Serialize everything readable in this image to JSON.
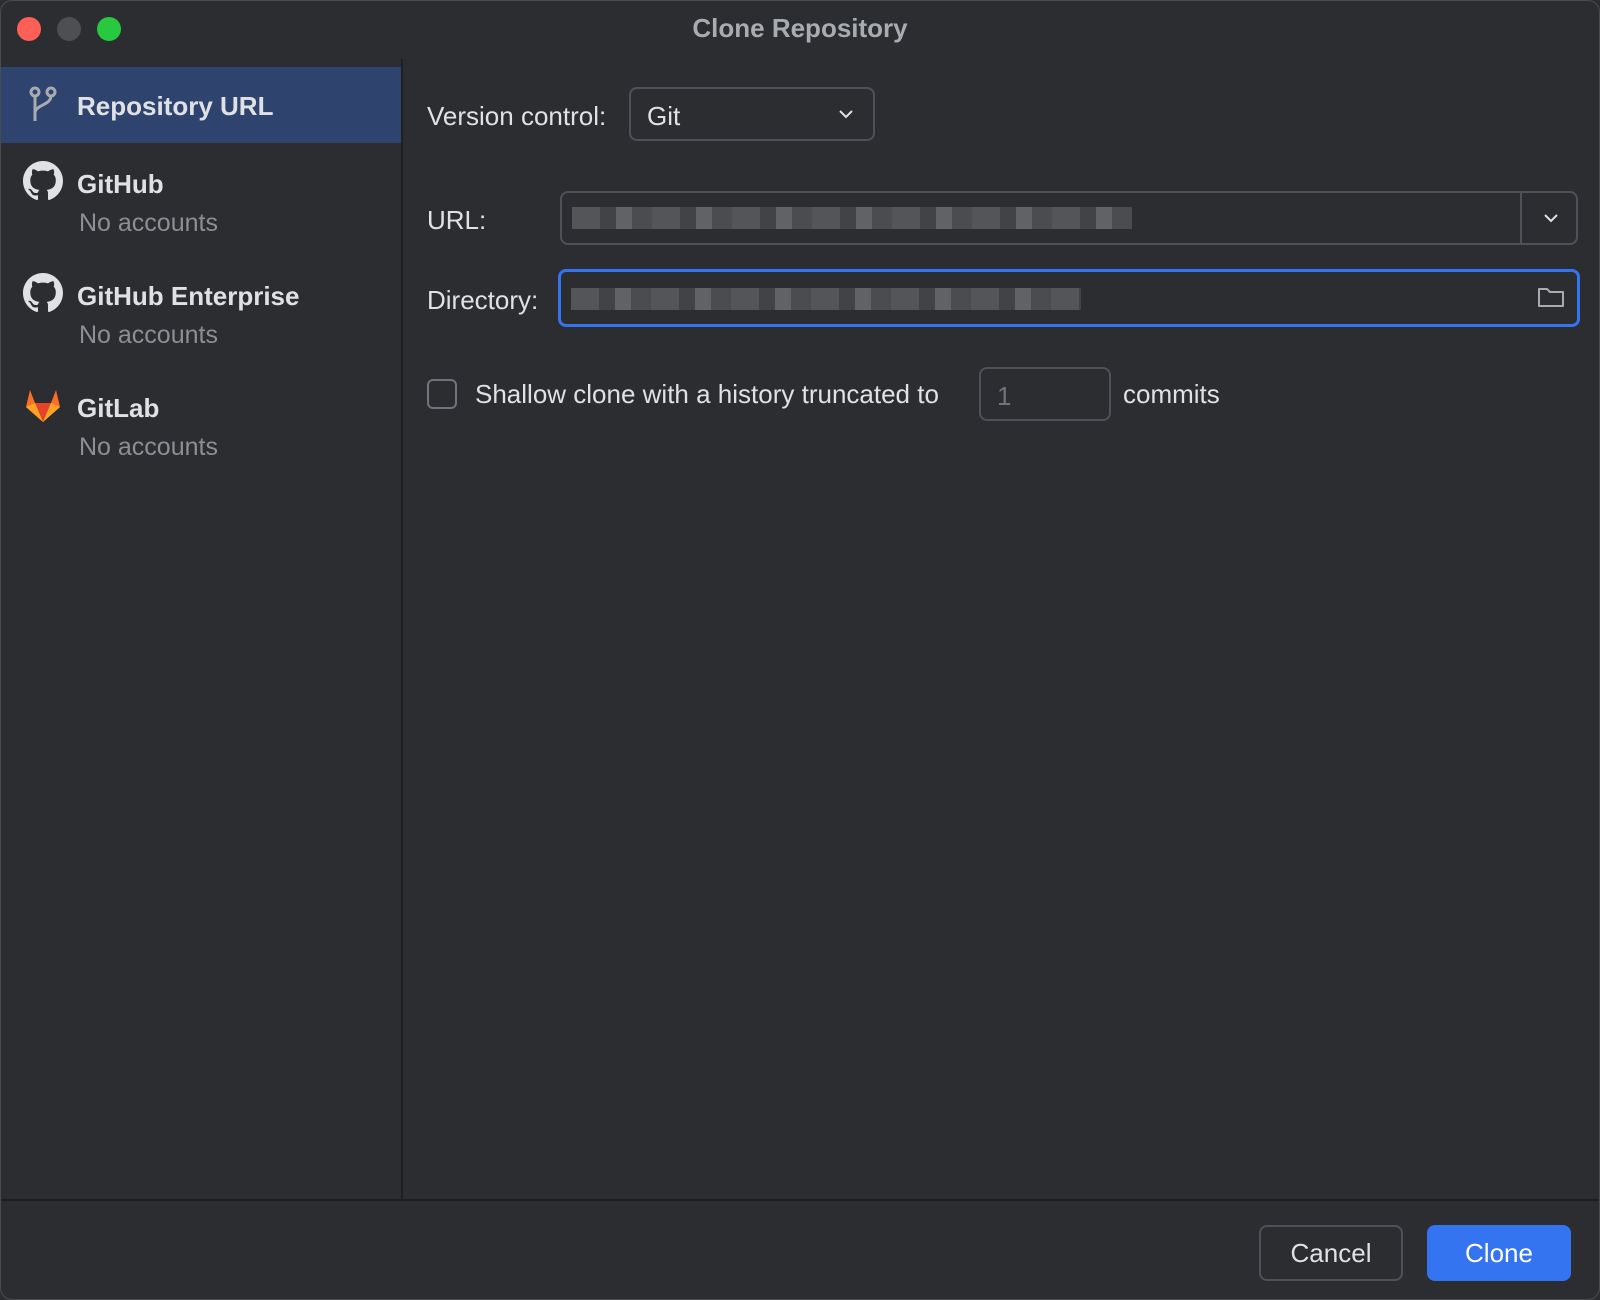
{
  "window": {
    "title": "Clone Repository"
  },
  "sidebar": {
    "items": [
      {
        "title": "Repository URL",
        "subtitle": "",
        "icon": "branch-icon",
        "selected": true
      },
      {
        "title": "GitHub",
        "subtitle": "No accounts",
        "icon": "github-icon"
      },
      {
        "title": "GitHub Enterprise",
        "subtitle": "No accounts",
        "icon": "github-icon"
      },
      {
        "title": "GitLab",
        "subtitle": "No accounts",
        "icon": "gitlab-icon"
      }
    ]
  },
  "form": {
    "version_control_label": "Version control:",
    "version_control_value": "Git",
    "url_label": "URL:",
    "directory_label": "Directory:",
    "shallow_label": "Shallow clone with a history truncated to",
    "shallow_depth": "1",
    "commits_label": "commits"
  },
  "footer": {
    "cancel": "Cancel",
    "clone": "Clone"
  },
  "colors": {
    "accent": "#3574f0",
    "selected_bg": "#2e436e",
    "gitlab": "#fc6d26"
  }
}
